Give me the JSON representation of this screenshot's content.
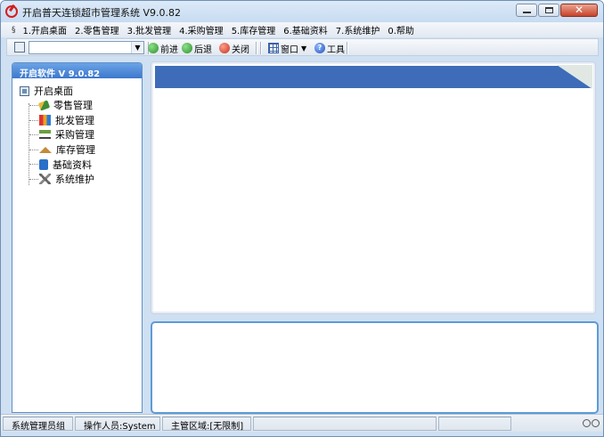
{
  "window": {
    "title": "开启普天连锁超市管理系统 V9.0.82",
    "controls": {
      "minimize": "—",
      "maximize": "□",
      "close": "✕"
    }
  },
  "menubar": {
    "system_glyph": "§",
    "items": [
      {
        "label": "1.开启桌面"
      },
      {
        "label": "2.零售管理"
      },
      {
        "label": "3.批发管理"
      },
      {
        "label": "4.采购管理"
      },
      {
        "label": "5.库存管理"
      },
      {
        "label": "6.基础资料"
      },
      {
        "label": "7.系统维护"
      },
      {
        "label": "0.帮助"
      }
    ]
  },
  "toolbar": {
    "select_value": "",
    "select_arrow": "▼",
    "forward_label": "前进",
    "back_label": "后退",
    "close_label": "关闭",
    "window_label": "窗口",
    "window_arrow": "▼",
    "tools_label": "工具",
    "tools_glyph": "?"
  },
  "sidebar": {
    "header": "开启软件 V 9.0.82",
    "root_label": "开启桌面",
    "items": [
      {
        "label": "零售管理",
        "icon": "retail-icon"
      },
      {
        "label": "批发管理",
        "icon": "wholesale-icon"
      },
      {
        "label": "采购管理",
        "icon": "purchase-icon"
      },
      {
        "label": "库存管理",
        "icon": "stock-icon"
      },
      {
        "label": "基础资料",
        "icon": "basic-data-icon"
      },
      {
        "label": "系统维护",
        "icon": "maintenance-icon"
      }
    ]
  },
  "statusbar": {
    "group": "系统管理员组",
    "operator": "操作人员:System",
    "area": "主管区域:[无限制]"
  },
  "colors": {
    "accent": "#3e6cb8",
    "sidebar_header": "#4a86d4",
    "window_frame": "#cfe0f3"
  }
}
